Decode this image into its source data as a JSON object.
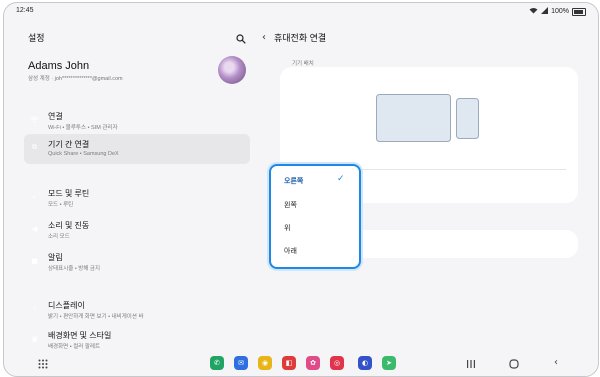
{
  "status": {
    "time": "12:45",
    "battery": "100%"
  },
  "left": {
    "title": "설정",
    "profile": {
      "name": "Adams John",
      "account": "삼성 계정 · joh**************@gmail.com"
    },
    "menu": [
      {
        "title": "연결",
        "subtitle": "Wi-Fi • 블루투스 • SIM 관리자",
        "icon": "wifi-icon",
        "color": "#2f8ee8"
      },
      {
        "title": "기기 간 연결",
        "subtitle": "Quick Share • Samsung DeX",
        "icon": "link-devices-icon",
        "color": "#3db6a9"
      },
      {
        "title": "모드 및 루틴",
        "subtitle": "모드 • 루틴",
        "icon": "modes-icon",
        "color": "#3a6fd8"
      },
      {
        "title": "소리 및 진동",
        "subtitle": "소리 모드",
        "icon": "sound-icon",
        "color": "#9a5ee0"
      },
      {
        "title": "알림",
        "subtitle": "상태표시줄 • 방해 금지",
        "icon": "notification-icon",
        "color": "#e05858"
      },
      {
        "title": "디스플레이",
        "subtitle": "밝기 • 편안하게 화면 보기 • 내비게이션 바",
        "icon": "display-icon",
        "color": "#54b85a"
      },
      {
        "title": "배경화면 및 스타일",
        "subtitle": "배경화면 • 컬러 팔레트",
        "icon": "wallpaper-icon",
        "color": "#d84a8a"
      }
    ]
  },
  "right": {
    "title": "휴대전화 연결",
    "position_label": "기기 배치",
    "options": [
      "오른쪽",
      "왼쪽",
      "위",
      "아래"
    ],
    "selected_option": "오른쪽"
  },
  "dock_apps": [
    {
      "name": "phone-app-icon",
      "color": "#1fa463",
      "glyph": "✆"
    },
    {
      "name": "messages-app-icon",
      "color": "#2f6fe0",
      "glyph": "✉"
    },
    {
      "name": "chrome-app-icon",
      "color": "#e8b417",
      "glyph": "◉"
    },
    {
      "name": "flipboard-app-icon",
      "color": "#e03b3b",
      "glyph": "◧"
    },
    {
      "name": "blossom-app-icon",
      "color": "#e04b8a",
      "glyph": "✿"
    },
    {
      "name": "camera-app-icon",
      "color": "#e0344c",
      "glyph": "◎"
    },
    {
      "name": "samsung-internet-app-icon",
      "color": "#3553c8",
      "glyph": "◐"
    },
    {
      "name": "share-app-icon",
      "color": "#3cba6b",
      "glyph": "➤"
    }
  ]
}
